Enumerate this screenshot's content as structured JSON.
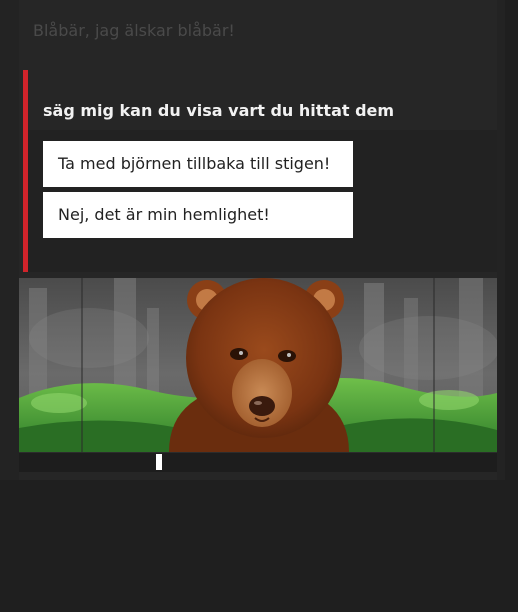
{
  "story": {
    "previous_line": "Blåbär, jag älskar blåbär!",
    "question": "säg mig kan du visa vart du hittat dem",
    "choices": [
      {
        "label": "Ta med björnen tillbaka till stigen!"
      },
      {
        "label": "Nej, det är min hemlighet!"
      }
    ]
  },
  "scene": {
    "character_icon": "bear-illustration",
    "background_icon": "forest-background"
  },
  "player": {
    "progress": 0.29
  },
  "colors": {
    "accent": "#d0242b",
    "background": "#1f1f1f",
    "choice_background": "#ffffff"
  }
}
